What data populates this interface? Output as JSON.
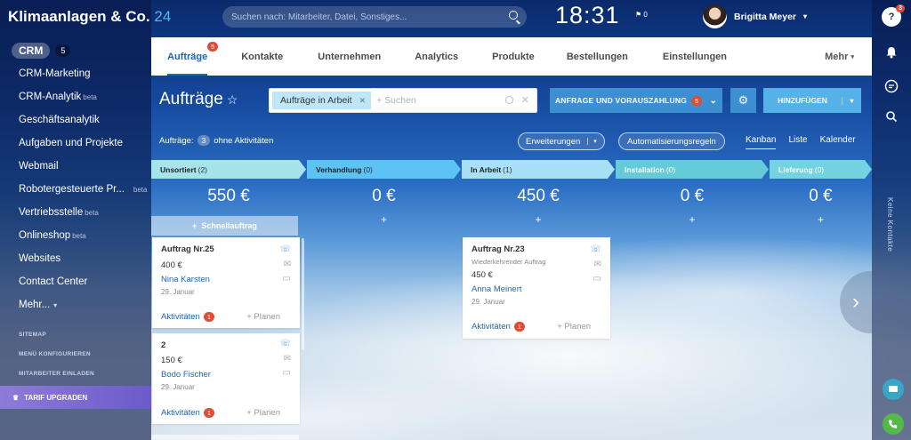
{
  "app": {
    "title": "Klimaanlagen & Co.",
    "title_num": "24"
  },
  "search": {
    "placeholder": "Suchen nach: Mitarbeiter, Datei, Sonstiges..."
  },
  "clock": "18:31",
  "flag_count": "0",
  "user": {
    "name": "Brigitta Meyer"
  },
  "sidebar": {
    "crm_label": "CRM",
    "crm_count": "5",
    "items": [
      {
        "label": "CRM-Marketing",
        "beta": ""
      },
      {
        "label": "CRM-Analytik",
        "beta": "beta"
      },
      {
        "label": "Geschäftsanalytik",
        "beta": ""
      },
      {
        "label": "Aufgaben und Projekte",
        "beta": ""
      },
      {
        "label": "Webmail",
        "beta": ""
      },
      {
        "label": "Robotergesteuerte Pr...",
        "beta": "beta"
      },
      {
        "label": "Vertriebsstelle",
        "beta": "beta"
      },
      {
        "label": "Onlineshop",
        "beta": "beta"
      },
      {
        "label": "Websites",
        "beta": ""
      },
      {
        "label": "Contact Center",
        "beta": ""
      },
      {
        "label": "Mehr...",
        "beta": ""
      }
    ],
    "sitemap": "SITEMAP",
    "configure": "MENÜ KONFIGURIEREN",
    "invite": "MITARBEITER EINLADEN",
    "upgrade": "TARIF UPGRADEN"
  },
  "tabs": [
    {
      "label": "Aufträge",
      "badge": "5"
    },
    {
      "label": "Kontakte"
    },
    {
      "label": "Unternehmen"
    },
    {
      "label": "Analytics"
    },
    {
      "label": "Produkte"
    },
    {
      "label": "Bestellungen"
    },
    {
      "label": "Einstellungen"
    }
  ],
  "tabs_more": "Mehr",
  "page_title": "Aufträge",
  "filter": {
    "tag": "Aufträge in Arbeit",
    "placeholder": "+ Suchen"
  },
  "buttons": {
    "anfrage": "ANFRAGE UND VORAUSZAHLUNG",
    "anfrage_badge": "5",
    "add": "HINZUFÜGEN"
  },
  "info": {
    "prefix": "Aufträge:",
    "count": "3",
    "suffix": "ohne Aktivitäten"
  },
  "toolbar": {
    "extensions": "Erweiterungen",
    "automation": "Automatisierungsregeln"
  },
  "views": [
    "Kanban",
    "Liste",
    "Kalender"
  ],
  "rightbar": {
    "help_badge": "3",
    "vertical": "Keine Kontakte"
  },
  "columns": [
    {
      "title": "Unsortiert",
      "count": "(2)",
      "sum": "550 €",
      "color": "#a6e4ec"
    },
    {
      "title": "Verhandlung",
      "count": "(0)",
      "sum": "0 €",
      "color": "#5cc3f4"
    },
    {
      "title": "In Arbeit",
      "count": "(1)",
      "sum": "450 €",
      "color": "#a8e0f8"
    },
    {
      "title": "Installation",
      "count": "(0)",
      "sum": "0 €",
      "color": "#66cbd8"
    },
    {
      "title": "Lieferung",
      "count": "(0)",
      "sum": "0 €",
      "color": "#74d3e0"
    }
  ],
  "quick_label": "Schnellauftrag",
  "cards": [
    {
      "title": "Auftrag Nr.25",
      "subtitle": "",
      "amount": "400 €",
      "contact": "Nina Karsten",
      "date": "29. Januar",
      "activities": "Aktivitäten",
      "act_count": "1",
      "plan": "+ Planen"
    },
    {
      "title": "2",
      "subtitle": "",
      "amount": "150 €",
      "contact": "Bodo Fischer",
      "date": "29. Januar",
      "activities": "Aktivitäten",
      "act_count": "1",
      "plan": "+ Planen"
    },
    {
      "title": "Auftrag Nr.23",
      "subtitle": "Wiederkehrender Auftrag",
      "amount": "450 €",
      "contact": "Anna Meinert",
      "date": "29. Januar",
      "activities": "Aktivitäten",
      "act_count": "1",
      "plan": "+ Planen"
    }
  ]
}
